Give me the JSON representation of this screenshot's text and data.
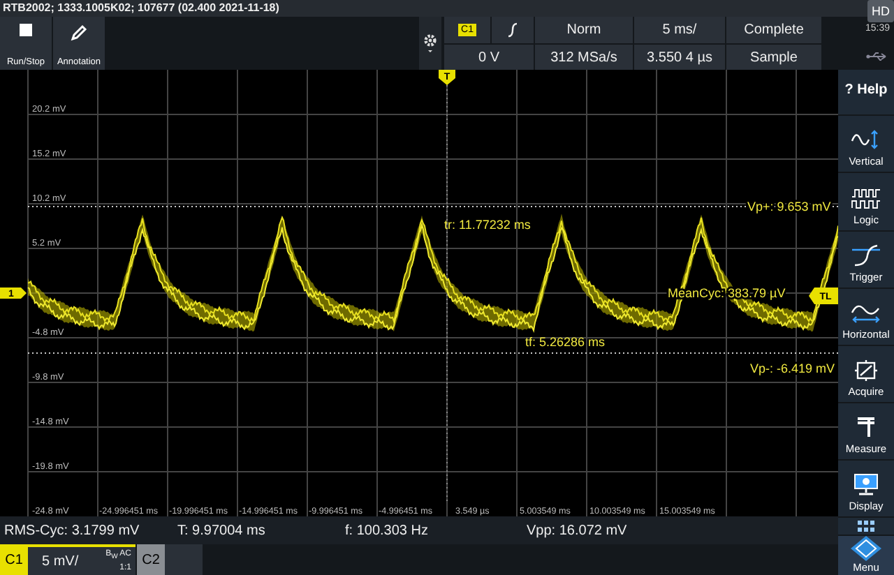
{
  "title_bar": {
    "text": "RTB2002; 1333.1005K02; 107677 (02.400 2021-11-18)"
  },
  "toolbar": {
    "buttons": [
      {
        "label": "Run/Stop",
        "kind": "stop"
      },
      {
        "label": "Annotation",
        "kind": "pen"
      }
    ]
  },
  "acquisition": {
    "channel": "C1",
    "trigger_mode": "Norm",
    "time_scale": "5 ms/",
    "status": "Complete",
    "trigger_level": "0 V",
    "sample_rate": "312 MSa/s",
    "position": "3.550 4 µs",
    "mode": "Sample"
  },
  "status_corner": {
    "badge": "HD",
    "time": "15:39"
  },
  "plot": {
    "y_labels": [
      "20.2 mV",
      "15.2 mV",
      "10.2 mV",
      "5.2 mV",
      "-4.8 mV",
      "-9.8 mV",
      "-14.8 mV",
      "-19.8 mV",
      "-24.8 mV"
    ],
    "x_labels": [
      "-24.996451 ms",
      "-19.996451 ms",
      "-14.996451 ms",
      "-9.996451 ms",
      "-4.996451 ms",
      "3.549 µs",
      "5.003549 ms",
      "10.003549 ms",
      "15.003549 ms"
    ],
    "trigger_marker": "T",
    "channel_marker": "1",
    "trigger_level_marker": "TL",
    "annotations": [
      {
        "kind": "rise",
        "text": "tr: 11.77232 ms"
      },
      {
        "kind": "fall",
        "text": "tf: 5.26286 ms"
      },
      {
        "kind": "mean",
        "text": "MeanCyc: 383.79 µV"
      },
      {
        "kind": "peak_pos",
        "text": "Vp+: 9.653 mV"
      },
      {
        "kind": "peak_neg",
        "text": "Vp-: -6.419 mV"
      }
    ]
  },
  "measurements": [
    "RMS-Cyc: 3.1799 mV",
    "T: 9.97004 ms",
    "f: 100.303 Hz",
    "Vpp: 16.072 mV"
  ],
  "channels": [
    {
      "label": "C1",
      "selected": true,
      "scale": "5 mV/",
      "coupling": "B$_{W}$ AC",
      "probe": "1:1"
    },
    {
      "label": "C2",
      "selected": false
    }
  ],
  "side_menu": [
    {
      "kind": "help",
      "label": "? Help"
    },
    {
      "kind": "vertical",
      "label": "Vertical"
    },
    {
      "kind": "logic",
      "label": "Logic"
    },
    {
      "kind": "trigger",
      "label": "Trigger"
    },
    {
      "kind": "horizontal",
      "label": "Horizontal"
    },
    {
      "kind": "acquire",
      "label": "Acquire"
    },
    {
      "kind": "measure",
      "label": "Measure"
    },
    {
      "kind": "display",
      "label": "Display"
    },
    {
      "kind": "apps"
    },
    {
      "kind": "menu",
      "label": "Menu"
    }
  ]
}
